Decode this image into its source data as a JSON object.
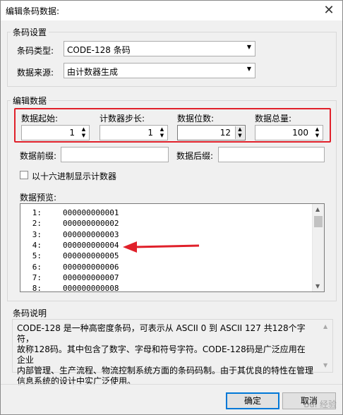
{
  "window": {
    "title": "编辑条码数据:",
    "close_symbol": "✕"
  },
  "barcode_settings": {
    "group_label": "条码设置",
    "type_label": "条码类型:",
    "type_value": "CODE-128 条码",
    "source_label": "数据来源:",
    "source_value": "由计数器生成"
  },
  "edit_data": {
    "group_label": "编辑数据",
    "start_label": "数据起始:",
    "start_value": "1",
    "step_label": "计数器步长:",
    "step_value": "1",
    "digits_label": "数据位数:",
    "digits_value": "12",
    "total_label": "数据总量:",
    "total_value": "100",
    "prefix_label": "数据前缀:",
    "prefix_value": "",
    "suffix_label": "数据后缀:",
    "suffix_value": "",
    "hex_checkbox_label": "以十六进制显示计数器",
    "hex_checked": false,
    "preview_label": "数据预览:",
    "preview_rows": [
      {
        "idx": "1:",
        "code": "000000000001"
      },
      {
        "idx": "2:",
        "code": "000000000002"
      },
      {
        "idx": "3:",
        "code": "000000000003"
      },
      {
        "idx": "4:",
        "code": "000000000004"
      },
      {
        "idx": "5:",
        "code": "000000000005"
      },
      {
        "idx": "6:",
        "code": "000000000006"
      },
      {
        "idx": "7:",
        "code": "000000000007"
      },
      {
        "idx": "8:",
        "code": "000000000008"
      }
    ]
  },
  "description": {
    "group_label": "条码说明",
    "line1": "CODE-128 是一种高密度条码，可表示从 ASCII 0 到 ASCII 127 共128个字符，",
    "line2": "故称128码。其中包含了数字、字母和符号字符。CODE-128码是广泛应用在企业",
    "line3": "内部管理、生产流程、物流控制系统方面的条码码制。由于其优良的特性在管理",
    "line4": "信息系统的设计中实广泛使用。"
  },
  "buttons": {
    "ok": "确定",
    "cancel": "取消"
  },
  "watermark": "Bai 经验",
  "colors": {
    "highlight": "#e0202a",
    "arrow": "#e0202a",
    "accent": "#0078d7"
  }
}
